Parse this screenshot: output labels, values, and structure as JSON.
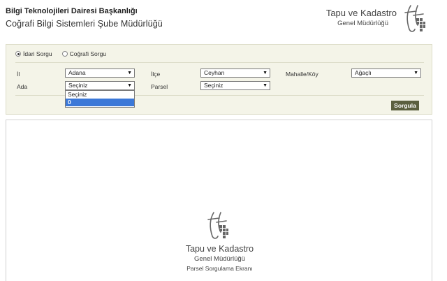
{
  "header": {
    "title_line1": "Bilgi Teknolojileri Dairesi Başkanlığı",
    "title_line2": "Coğrafi Bilgi Sistemleri Şube Müdürlüğü"
  },
  "brand": {
    "name": "Tapu ve Kadastro",
    "subtitle": "Genel Müdürlüğü",
    "logo_icon": "tkgm-logo-icon"
  },
  "query": {
    "radio_options": [
      {
        "label": "İdari Sorgu",
        "selected": true
      },
      {
        "label": "Coğrafi Sorgu",
        "selected": false
      }
    ],
    "fields": {
      "il": {
        "label": "İl",
        "value": "Adana"
      },
      "ilce": {
        "label": "İlçe",
        "value": "Ceyhan"
      },
      "mahalle": {
        "label": "Mahalle/Köy",
        "value": "Ağaçlı"
      },
      "ada": {
        "label": "Ada",
        "value": "Seçiniz"
      },
      "parsel": {
        "label": "Parsel",
        "value": "Seçiniz"
      }
    },
    "ada_dropdown_options": [
      {
        "label": "Seçiniz",
        "highlighted": false
      },
      {
        "label": "0",
        "highlighted": true
      }
    ],
    "submit_label": "Sorgula"
  },
  "map": {
    "brand_name": "Tapu ve Kadastro",
    "brand_subtitle": "Genel Müdürlüğü",
    "screen_title": "Parsel Sorgulama Ekranı"
  },
  "colors": {
    "panel_bg": "#f4f4e8",
    "button_bg": "#5b5f3f",
    "highlight": "#3b78d8"
  }
}
